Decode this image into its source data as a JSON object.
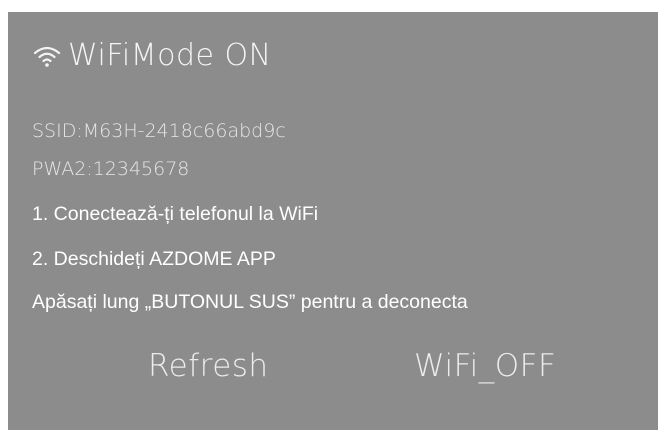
{
  "header": {
    "icon": "wifi-icon",
    "title": "WiFiMode ON"
  },
  "info": {
    "ssid": "SSID:M63H-2418c66abd9c",
    "password": "PWA2:12345678"
  },
  "steps": [
    "1. Conectează-ți telefonul la WiFi",
    "2. Deschideți AZDOME APP",
    "Apăsați lung „BUTONUL SUS” pentru a deconecta"
  ],
  "buttons": {
    "refresh": "Refresh",
    "wifi_off": "WiFi_OFF"
  },
  "colors": {
    "background": "#8c8c8c",
    "text": "#ffffff"
  }
}
